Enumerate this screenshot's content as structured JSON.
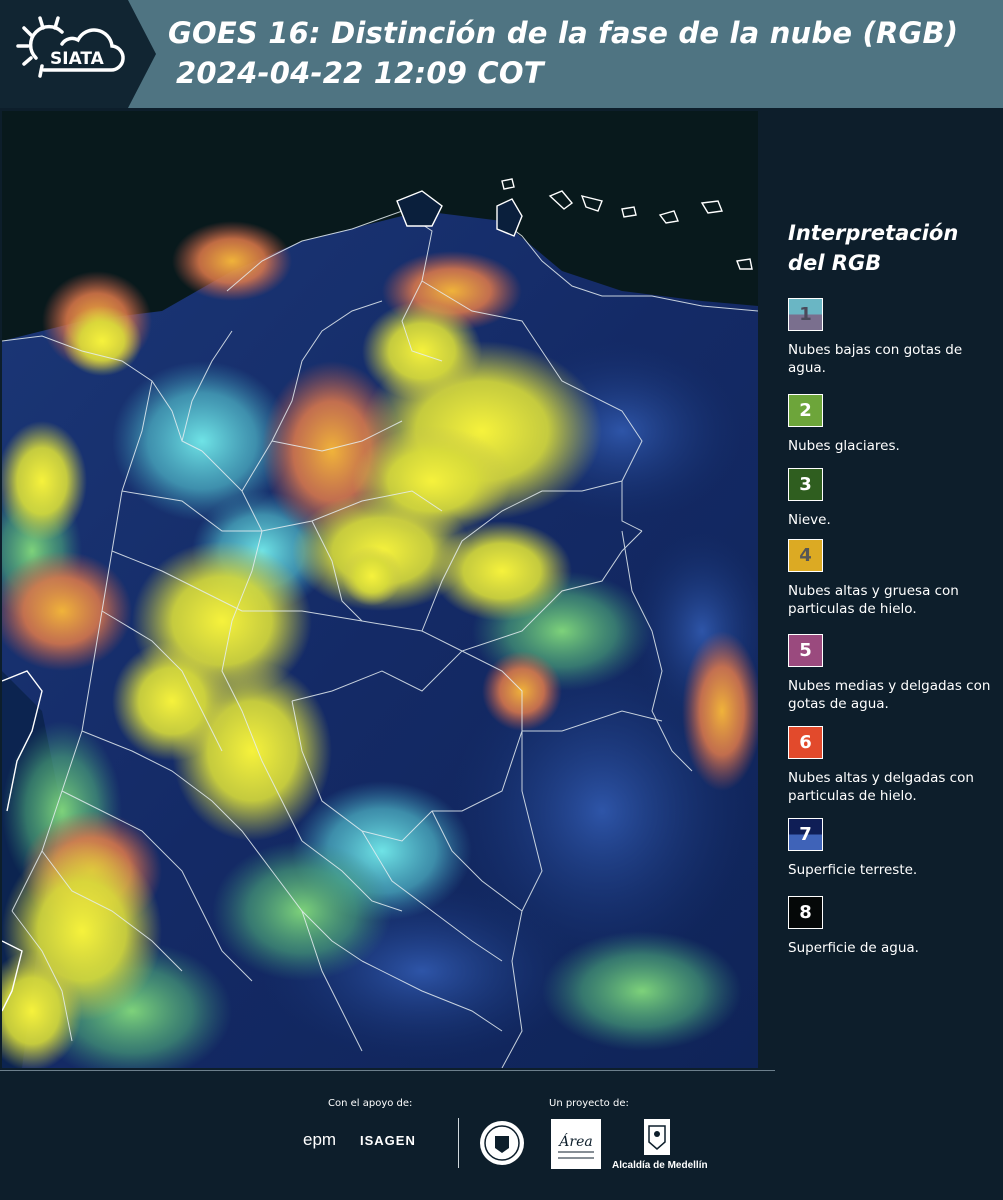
{
  "header": {
    "logo_text": "SIATA",
    "title_line1": "GOES 16: Distinción de la fase de la nube (RGB)",
    "title_line2": "2024-04-22 12:09 COT"
  },
  "legend": {
    "title": "Interpretación del RGB",
    "items": [
      {
        "number": "1",
        "label": "Nubes bajas con gotas de agua.",
        "color_top": "#6ab6c4",
        "color_bottom": "#7a6f8e",
        "number_color": "#4a4a5a"
      },
      {
        "number": "2",
        "label": "Nubes glaciares.",
        "color_top": "#6da53a",
        "color_bottom": "#6da53a",
        "number_color": "#ffffff"
      },
      {
        "number": "3",
        "label": "Nieve.",
        "color_top": "#2f5e1f",
        "color_bottom": "#2f5e1f",
        "number_color": "#ffffff"
      },
      {
        "number": "4",
        "label": "Nubes altas y gruesa con particulas de hielo.",
        "color_top": "#dcaa23",
        "color_bottom": "#dcaa23",
        "number_color": "#555555"
      },
      {
        "number": "5",
        "label": "Nubes medias y delgadas con gotas de agua.",
        "color_top": "#9a4a7e",
        "color_bottom": "#9a4a7e",
        "number_color": "#ffffff"
      },
      {
        "number": "6",
        "label": "Nubes altas y delgadas con particulas de hielo.",
        "color_top": "#e24a2c",
        "color_bottom": "#e24a2c",
        "number_color": "#ffffff"
      },
      {
        "number": "7",
        "label": "Superficie terreste.",
        "color_top": "#0f1e56",
        "color_bottom": "#3f63b8",
        "number_color": "#ffffff"
      },
      {
        "number": "8",
        "label": "Superficie de agua.",
        "color_top": "#050808",
        "color_bottom": "#050808",
        "number_color": "#ffffff"
      }
    ]
  },
  "footer": {
    "support_label": "Con el apoyo de:",
    "project_label": "Un proyecto de:",
    "epm": "epm",
    "isagen": "ISAGEN",
    "metro_text": "Área",
    "alcaldia": "Alcaldía de Medellín"
  },
  "colors": {
    "header_bg": "#4f7482",
    "page_bg": "#0d1e2b",
    "logo_bg": "#112532"
  }
}
